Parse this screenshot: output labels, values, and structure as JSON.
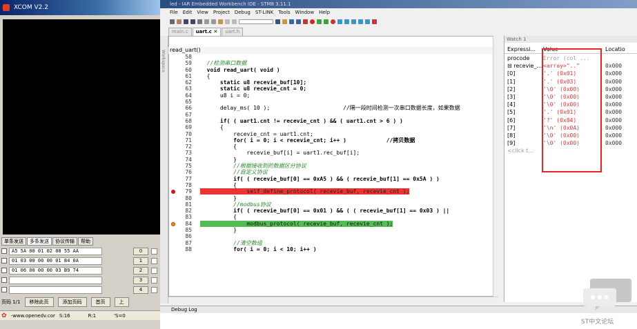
{
  "xcom": {
    "title": "XCOM V2.2",
    "tabs": [
      "单条发送",
      "多条发送",
      "协议传输",
      "帮助"
    ],
    "rows": [
      {
        "hex": "A5 5A 00 01 02 08 55 AA",
        "button": "0"
      },
      {
        "hex": "01 03 00 00 00 01 84 0A",
        "button": "1"
      },
      {
        "hex": "01 06 00 00 00 03 B9 74",
        "button": "2"
      },
      {
        "hex": "",
        "button": "3"
      },
      {
        "hex": "",
        "button": "4"
      }
    ],
    "pager": {
      "page": "页码 1/1",
      "delete": "移除此页",
      "add": "添加页码",
      "first": "首页",
      "prev": "上"
    },
    "status": {
      "site": "-www.openedv.cor",
      "s": "S:16",
      "r": "R:1",
      "cts": "'S=0"
    }
  },
  "iar": {
    "title": "led - IAR Embedded Workbench IDE - STM8 3.11.1",
    "menu": [
      "File",
      "Edit",
      "View",
      "Project",
      "Debug",
      "ST-LINK",
      "Tools",
      "Window",
      "Help"
    ],
    "tabs": [
      "main.c",
      "uart.c",
      "uart.h"
    ],
    "function": "read_uart()",
    "workspace": "Workspace",
    "debug_log": "Debug Log",
    "code": [
      {
        "n": "58",
        "t": ""
      },
      {
        "n": "59",
        "t": "  //检测串口数据"
      },
      {
        "n": "60",
        "t": "  void read_uart( void )"
      },
      {
        "n": "61",
        "t": "  {"
      },
      {
        "n": "62",
        "t": "      static u8 recevie_buf[10];"
      },
      {
        "n": "63",
        "t": "      static u8 recevie_cnt = 0;"
      },
      {
        "n": "64",
        "t": "      u8 i = 0;"
      },
      {
        "n": "65",
        "t": ""
      },
      {
        "n": "66",
        "t": "      delay_ms( 10 );                      //隔一段时间检测一次串口数据长度，如果数据"
      },
      {
        "n": "67",
        "t": ""
      },
      {
        "n": "68",
        "t": "      if( ( uart1.cnt != recevie_cnt ) && ( uart1.cnt > 6 ) )"
      },
      {
        "n": "69",
        "t": "      {"
      },
      {
        "n": "70",
        "t": "          recevie_cnt = uart1.cnt;"
      },
      {
        "n": "71",
        "t": "          for( i = 0; i < recevie_cnt; i++ )            //拷贝数据"
      },
      {
        "n": "72",
        "t": "          {"
      },
      {
        "n": "73",
        "t": "              recevie_buf[i] = uart1.rec_buf[i];"
      },
      {
        "n": "74",
        "t": "          }"
      },
      {
        "n": "75",
        "t": "          //根据接收到的数据区分协议"
      },
      {
        "n": "76",
        "t": "          //自定义协议"
      },
      {
        "n": "77",
        "t": "          if( ( recevie_buf[0] == 0xA5 ) && ( recevie_buf[1] == 0x5A ) )"
      },
      {
        "n": "78",
        "t": "          {"
      },
      {
        "n": "79",
        "t": "              self_define_protocol( recevie_buf, recevie_cnt );"
      },
      {
        "n": "80",
        "t": "          }"
      },
      {
        "n": "81",
        "t": "          //modbus协议"
      },
      {
        "n": "82",
        "t": "          if( ( recevie_buf[0] == 0x01 ) && ( ( recevie_buf[1] == 0x03 ) ||"
      },
      {
        "n": "83",
        "t": "          {"
      },
      {
        "n": "84",
        "t": "              modbus_protocol( recevie_buf, recevie_cnt );"
      },
      {
        "n": "85",
        "t": "          }"
      },
      {
        "n": "86",
        "t": ""
      },
      {
        "n": "87",
        "t": "          //清空数组"
      },
      {
        "n": "88",
        "t": "          for( i = 0; i < 10; i++ )"
      }
    ]
  },
  "watch": {
    "title": "Watch 1",
    "headers": [
      "Expressi...",
      "Value",
      "Locatio"
    ],
    "rows": [
      {
        "expr": "procode",
        "value": "Error (col ...",
        "loc": ""
      },
      {
        "expr": "⊟ recevie_...",
        "value": "<array>\"..\"",
        "loc": "0x000"
      },
      {
        "expr": "[0]",
        "value": "'.' (0x01)",
        "loc": "0x000"
      },
      {
        "expr": "[1]",
        "value": "'.' (0x03)",
        "loc": "0x000"
      },
      {
        "expr": "[2]",
        "value": "'\\0' (0x00)",
        "loc": "0x000"
      },
      {
        "expr": "[3]",
        "value": "'\\0' (0x00)",
        "loc": "0x000"
      },
      {
        "expr": "[4]",
        "value": "'\\0' (0x00)",
        "loc": "0x000"
      },
      {
        "expr": "[5]",
        "value": "'.' (0x01)",
        "loc": "0x000"
      },
      {
        "expr": "[6]",
        "value": "'?' (0x84)",
        "loc": "0x000"
      },
      {
        "expr": "[7]",
        "value": "'\\n' (0x0A)",
        "loc": "0x000"
      },
      {
        "expr": "[8]",
        "value": "'\\0' (0x00)",
        "loc": "0x000"
      },
      {
        "expr": "[9]",
        "value": "'\\0' (0x00)",
        "loc": "0x000"
      },
      {
        "expr": "<click t...",
        "value": "",
        "loc": ""
      }
    ]
  },
  "watermark": "ST中文论坛"
}
